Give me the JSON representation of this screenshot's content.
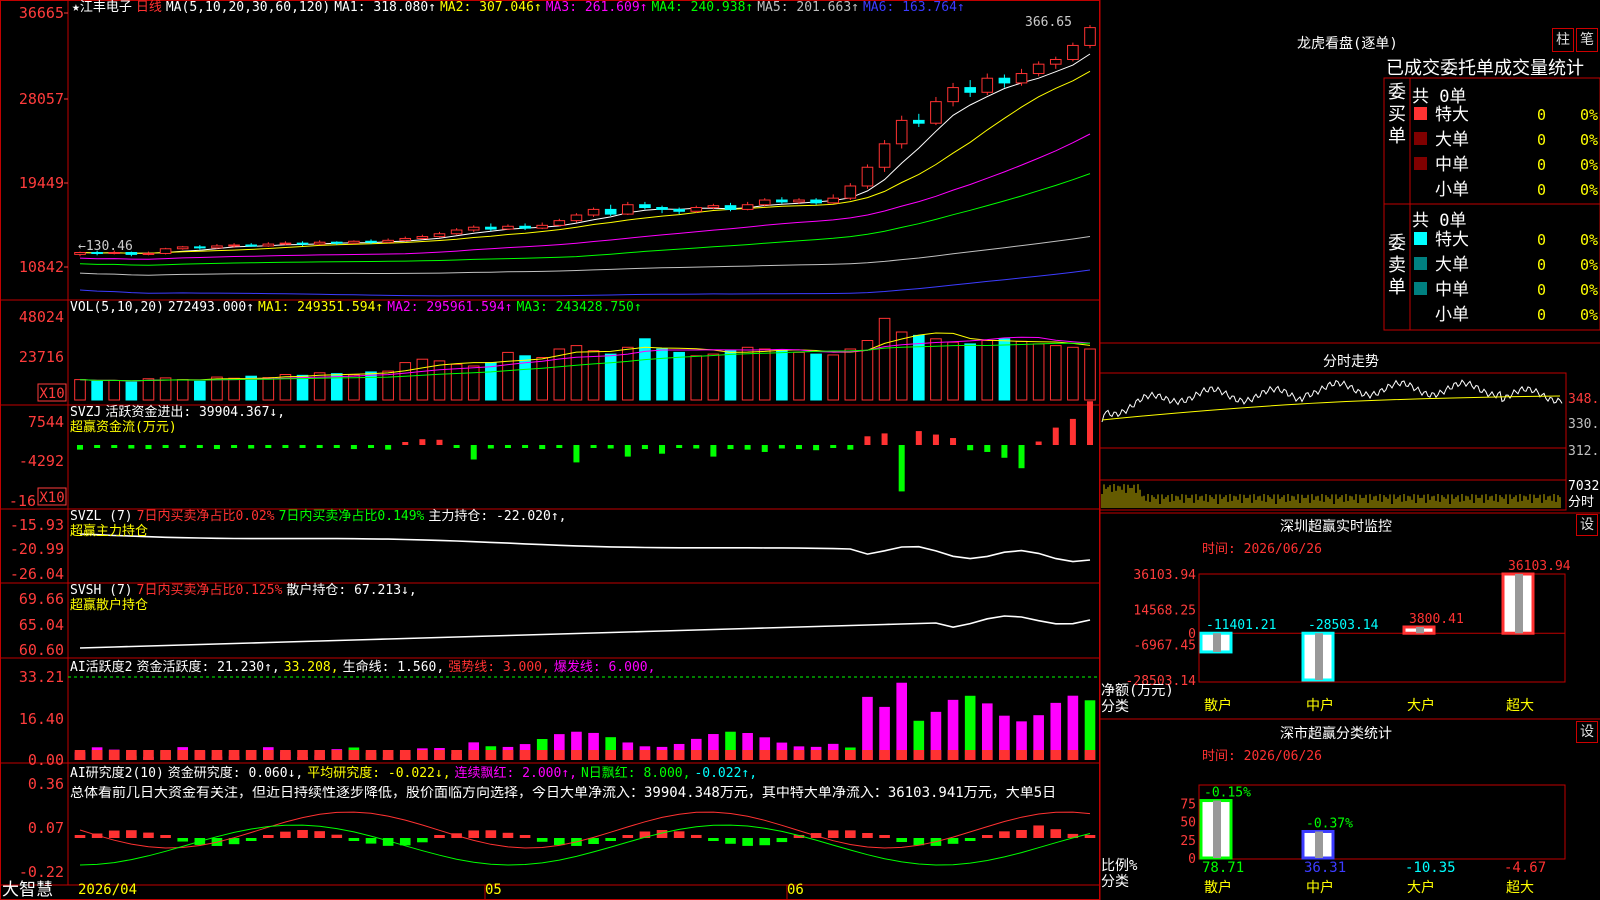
{
  "stock": {
    "name": "江丰电子",
    "star": "★",
    "period": "日线"
  },
  "colors": {
    "up": "#ff3232",
    "down": "#00ffff",
    "ma1": "#ffffff",
    "ma2": "#ffff00",
    "ma3": "#ff00ff",
    "ma4": "#00ff00",
    "ma5": "#c0c0c0",
    "ma6": "#3c3cff",
    "grid": "#c00000",
    "axis": "#ff3c3c",
    "yellowtxt": "#ffff00",
    "magenta": "#ff00ff",
    "cyan": "#00ffff",
    "green": "#00ff00",
    "dim_teal": "#008080",
    "dark_red": "#800000"
  },
  "price_header": {
    "ma_title": "MA(5,10,20,30,60,120)",
    "ma1": "MA1: 318.080↑",
    "ma2": "MA2: 307.046↑",
    "ma3": "MA3: 261.609↑",
    "ma4": "MA4: 240.938↑",
    "ma5": "MA5: 201.663↑",
    "ma6": "MA6: 163.764↑"
  },
  "price_axis": [
    "36665",
    "28057",
    "19449",
    "10842"
  ],
  "price_marks": {
    "high": "366.65",
    "low": "130.46"
  },
  "vol_header": {
    "title": "VOL(5,10,20)",
    "value": "272493.000↑",
    "ma1": "MA1: 249351.594↑",
    "ma2": "MA2: 295961.594↑",
    "ma3": "MA3: 243428.750↑"
  },
  "vol_axis": [
    "48024",
    "23716",
    "X10"
  ],
  "svzj": {
    "title": "SVZJ",
    "label": "活跃资金进出: 39904.367↓,",
    "name": "超赢资金流(万元)",
    "axis": [
      "7544",
      "-4292",
      "-16",
      "X10"
    ]
  },
  "svzl": {
    "title": "SVZL (7)",
    "t1": "7日内买卖净占比0.02%",
    "t2": "7日内买卖净占比0.149%",
    "t3": "主力持仓: -22.020↑,",
    "name": "超赢主力持仓",
    "axis": [
      "-15.93",
      "-20.99",
      "-26.04"
    ]
  },
  "svsh": {
    "title": "SVSH (7)",
    "t1": "7日内买卖净占比0.125%",
    "t2": "散户持仓: 67.213↓,",
    "name": "超赢散户持仓",
    "axis": [
      "69.66",
      "65.04",
      "60.60"
    ]
  },
  "aihy": {
    "title": "AI活跃度2",
    "t1": "资金活跃度: 21.230↑,",
    "t2": "33.208,",
    "t3": "生命线: 1.560,",
    "t4": "强势线: 3.000,",
    "t5": "爆发线: 6.000,",
    "axis": [
      "33.21",
      "16.40",
      "0.00"
    ]
  },
  "aiyj": {
    "title": "AI研究度2(10)",
    "t1": "资金研究度: 0.060↓,",
    "t2": "平均研究度: -0.022↓,",
    "t3": "连续飘红: 2.000↑,",
    "t4": "N日飘红: 8.000,",
    "t5": "-0.022↑,",
    "desc": "总体看前几日大资金有关注，但近日持续性逐步降低，股价面临方向选择，今日大单净流入：39904.348万元，其中特大单净流入：36103.941万元，大单5日",
    "axis": [
      "0.36",
      "0.07",
      "-0.22"
    ]
  },
  "xaxis": {
    "d1": "2026/04",
    "d2": "05",
    "d3": "06"
  },
  "brand": "大智慧",
  "lhkp": {
    "title": "龙虎看盘(逐单)",
    "btn1": "柱",
    "btn2": "笔",
    "sub": "已成交委托单成交量统计",
    "buy": {
      "label": "委买单",
      "total": "共 0单",
      "rows": [
        {
          "name": "特大",
          "v": "0",
          "p": "0%"
        },
        {
          "name": "大单",
          "v": "0",
          "p": "0%"
        },
        {
          "name": "中单",
          "v": "0",
          "p": "0%"
        },
        {
          "name": "小单",
          "v": "0",
          "p": "0%"
        }
      ]
    },
    "sell": {
      "label": "委卖单",
      "total": "共 0单",
      "rows": [
        {
          "name": "特大",
          "v": "0",
          "p": "0%"
        },
        {
          "name": "大单",
          "v": "0",
          "p": "0%"
        },
        {
          "name": "中单",
          "v": "0",
          "p": "0%"
        },
        {
          "name": "小单",
          "v": "0",
          "p": "0%"
        }
      ]
    }
  },
  "intraday": {
    "title": "分时走势",
    "axis": [
      "348.0",
      "330.0",
      "312.0",
      "7032",
      "分时"
    ]
  },
  "sz_monitor": {
    "title": "深圳超赢实时监控",
    "btn": "设",
    "time": "时间: 2026/06/26",
    "axis": [
      "36103.94",
      "14568.25",
      "0",
      "-6967.45",
      "-28503.14"
    ],
    "axis_title": "净额(万元)",
    "axis_title2": "分类",
    "categories": [
      "散户",
      "中户",
      "大户",
      "超大"
    ],
    "values": [
      -11401.21,
      -28503.14,
      3800.41,
      36103.94
    ],
    "labels": [
      "-11401.21",
      "-28503.14",
      "3800.41",
      "36103.94"
    ]
  },
  "sz_class": {
    "title": "深市超赢分类统计",
    "btn": "设",
    "time": "时间: 2026/06/26",
    "axis": [
      "75",
      "50",
      "25",
      "0"
    ],
    "axis_title": "比例%",
    "axis_title2": "分类",
    "categories": [
      "散户",
      "中户",
      "大户",
      "超大"
    ],
    "ratio": [
      78.71,
      36.31
    ],
    "pct": [
      "-0.15%",
      "-0.37%"
    ],
    "bottom": [
      "78.71",
      "36.31",
      "-10.35",
      "-4.67"
    ]
  },
  "chart_data": {
    "type": "candlestick",
    "candles": [
      [
        122,
        124,
        120,
        125
      ],
      [
        124,
        123,
        121,
        126
      ],
      [
        123,
        124,
        122,
        126
      ],
      [
        124,
        122,
        120,
        125
      ],
      [
        122,
        123,
        121,
        125
      ],
      [
        123,
        128,
        122,
        129
      ],
      [
        128,
        130,
        127,
        131
      ],
      [
        130,
        129,
        127,
        132
      ],
      [
        129,
        131,
        128,
        133
      ],
      [
        131,
        132,
        129,
        134
      ],
      [
        132,
        131,
        130,
        134
      ],
      [
        131,
        133,
        130,
        135
      ],
      [
        133,
        134,
        132,
        136
      ],
      [
        134,
        133,
        131,
        136
      ],
      [
        133,
        135,
        132,
        137
      ],
      [
        135,
        134,
        132,
        136
      ],
      [
        134,
        136,
        133,
        137
      ],
      [
        136,
        135,
        133,
        138
      ],
      [
        135,
        137,
        134,
        139
      ],
      [
        137,
        139,
        136,
        141
      ],
      [
        139,
        141,
        138,
        143
      ],
      [
        141,
        144,
        140,
        146
      ],
      [
        144,
        148,
        143,
        150
      ],
      [
        148,
        151,
        146,
        153
      ],
      [
        151,
        149,
        147,
        155
      ],
      [
        149,
        152,
        148,
        154
      ],
      [
        152,
        150,
        148,
        155
      ],
      [
        150,
        153,
        149,
        156
      ],
      [
        153,
        158,
        152,
        160
      ],
      [
        158,
        164,
        156,
        166
      ],
      [
        164,
        170,
        162,
        172
      ],
      [
        170,
        165,
        163,
        175
      ],
      [
        165,
        175,
        164,
        178
      ],
      [
        175,
        172,
        170,
        178
      ],
      [
        172,
        170,
        166,
        174
      ],
      [
        170,
        168,
        165,
        172
      ],
      [
        168,
        172,
        166,
        174
      ],
      [
        172,
        174,
        170,
        176
      ],
      [
        174,
        170,
        168,
        177
      ],
      [
        170,
        175,
        169,
        178
      ],
      [
        175,
        180,
        173,
        182
      ],
      [
        180,
        178,
        176,
        183
      ],
      [
        178,
        180,
        176,
        182
      ],
      [
        180,
        177,
        175,
        182
      ],
      [
        177,
        182,
        176,
        186
      ],
      [
        182,
        195,
        180,
        198
      ],
      [
        195,
        215,
        192,
        218
      ],
      [
        215,
        240,
        210,
        244
      ],
      [
        240,
        265,
        235,
        270
      ],
      [
        265,
        262,
        258,
        272
      ],
      [
        262,
        285,
        260,
        290
      ],
      [
        285,
        300,
        280,
        305
      ],
      [
        300,
        295,
        290,
        308
      ],
      [
        295,
        310,
        292,
        315
      ],
      [
        310,
        305,
        300,
        314
      ],
      [
        305,
        315,
        302,
        320
      ],
      [
        315,
        325,
        312,
        328
      ],
      [
        325,
        330,
        320,
        333
      ],
      [
        330,
        345,
        328,
        348
      ],
      [
        345,
        364,
        342,
        366.65
      ]
    ],
    "volume": [
      12000,
      11000,
      11500,
      10500,
      12500,
      13000,
      12000,
      11000,
      13500,
      12800,
      14000,
      13200,
      15000,
      14500,
      16000,
      15500,
      14800,
      16500,
      17000,
      22000,
      24000,
      23000,
      21000,
      20000,
      22000,
      28000,
      26000,
      25000,
      30000,
      32000,
      29000,
      27000,
      31000,
      36000,
      30000,
      28000,
      26000,
      27000,
      29000,
      31000,
      30000,
      29500,
      28000,
      27000,
      26500,
      30000,
      35000,
      48024,
      40000,
      38000,
      36000,
      34000,
      33000,
      35000,
      36000,
      34500,
      33000,
      32000,
      31000,
      30000
    ],
    "svzj": [
      -800,
      -500,
      -300,
      -600,
      -700,
      -400,
      -500,
      -300,
      -700,
      -400,
      -600,
      -500,
      -300,
      -400,
      -500,
      -300,
      -700,
      -400,
      -800,
      500,
      1000,
      900,
      -300,
      -2500,
      -600,
      -400,
      -300,
      -700,
      -500,
      -3000,
      -400,
      -600,
      -2000,
      -700,
      -1500,
      -500,
      -600,
      -2000,
      -700,
      -800,
      -1200,
      -600,
      -700,
      -900,
      -500,
      -800,
      1500,
      2000,
      -8000,
      2400,
      1800,
      1200,
      -900,
      -1200,
      -2200,
      -4000,
      600,
      3000,
      4500,
      7544
    ]
  }
}
